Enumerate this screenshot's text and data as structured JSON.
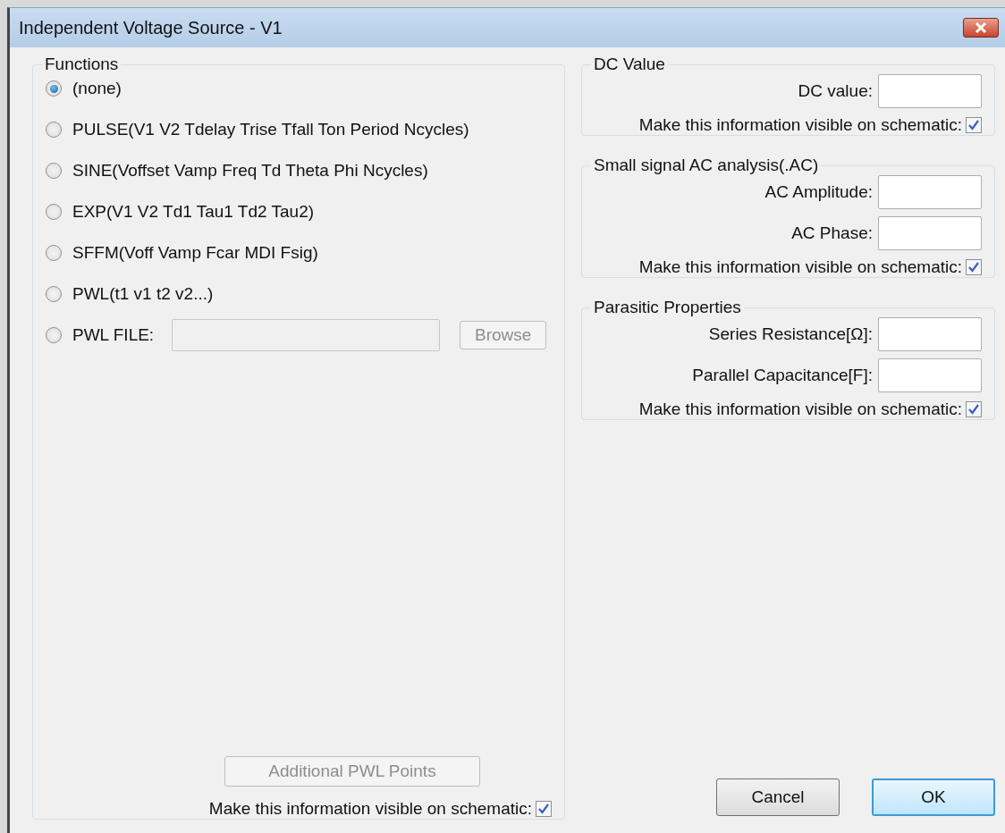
{
  "window": {
    "title": "Independent Voltage Source - V1"
  },
  "functions": {
    "title": "Functions",
    "options": [
      {
        "kind": "radio",
        "label": "(none)",
        "selected": true
      },
      {
        "kind": "radio",
        "label": "PULSE(V1 V2 Tdelay Trise Tfall Ton Period Ncycles)",
        "selected": false
      },
      {
        "kind": "radio",
        "label": "SINE(Voffset Vamp Freq Td Theta Phi Ncycles)",
        "selected": false
      },
      {
        "kind": "radio",
        "label": "EXP(V1 V2 Td1 Tau1 Td2 Tau2)",
        "selected": false
      },
      {
        "kind": "radio",
        "label": "SFFM(Voff Vamp Fcar MDI Fsig)",
        "selected": false
      },
      {
        "kind": "radio",
        "label": "PWL(t1 v1 t2 v2...)",
        "selected": false
      },
      {
        "kind": "file",
        "label": "PWL FILE:",
        "selected": false,
        "field_disabled": true,
        "button": "Browse",
        "button_disabled": true
      }
    ],
    "additional_button": {
      "label": "Additional PWL Points",
      "disabled": true
    },
    "visible": {
      "label": "Make this information visible on schematic:",
      "checked": true
    }
  },
  "groups": [
    {
      "title": "DC Value",
      "fields": [
        {
          "label": "DC value:"
        }
      ],
      "visible": {
        "label": "Make this information visible on schematic:",
        "checked": true
      }
    },
    {
      "title": "Small signal AC analysis(.AC)",
      "fields": [
        {
          "label": "AC Amplitude:"
        },
        {
          "label": "AC Phase:"
        }
      ],
      "visible": {
        "label": "Make this information visible on schematic:",
        "checked": true
      }
    },
    {
      "title": "Parasitic Properties",
      "fields": [
        {
          "label": "Series Resistance[Ω]:"
        },
        {
          "label": "Parallel Capacitance[F]:"
        }
      ],
      "visible": {
        "label": "Make this information visible on schematic:",
        "checked": true
      }
    }
  ],
  "buttons": [
    {
      "label": "Cancel",
      "default": false
    },
    {
      "label": "OK",
      "default": true
    }
  ]
}
